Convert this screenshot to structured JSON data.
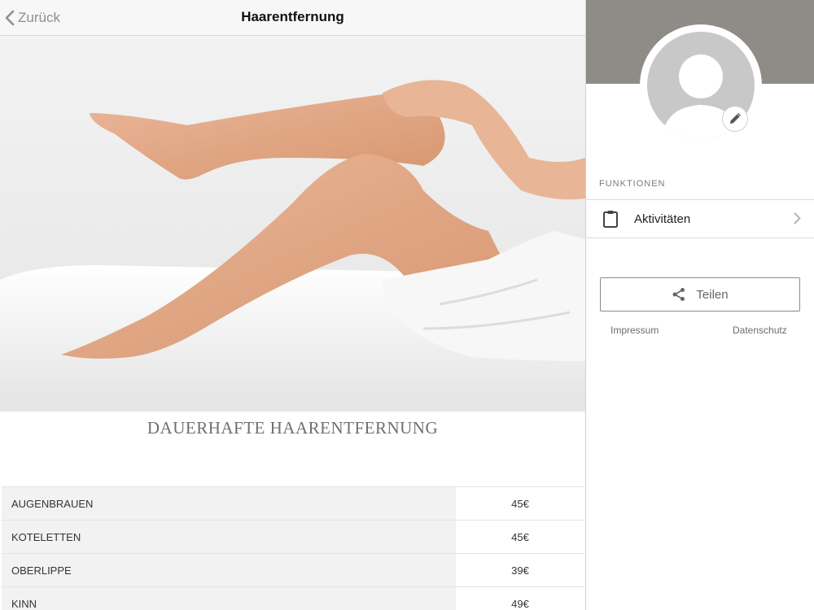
{
  "navbar": {
    "back_label": "Zurück",
    "title": "Haarentfernung"
  },
  "content": {
    "section_title": "DAUERHAFTE HAARENTFERNUNG",
    "prices": [
      {
        "name": "AUGENBRAUEN",
        "price": "45€"
      },
      {
        "name": "KOTELETTEN",
        "price": "45€"
      },
      {
        "name": "OBERLIPPE",
        "price": "39€"
      },
      {
        "name": "KINN",
        "price": "49€"
      }
    ]
  },
  "sidebar": {
    "section_label": "FUNKTIONEN",
    "menu": [
      {
        "label": "Aktivitäten",
        "icon": "clipboard-icon"
      }
    ],
    "share_label": "Teilen",
    "footer": {
      "impressum": "Impressum",
      "datenschutz": "Datenschutz"
    }
  },
  "colors": {
    "profile_band": "#8f8b87",
    "avatar_placeholder": "#c8c8c8",
    "table_name_bg": "#f2f2f2",
    "accent_gray": "#8e8e93"
  }
}
